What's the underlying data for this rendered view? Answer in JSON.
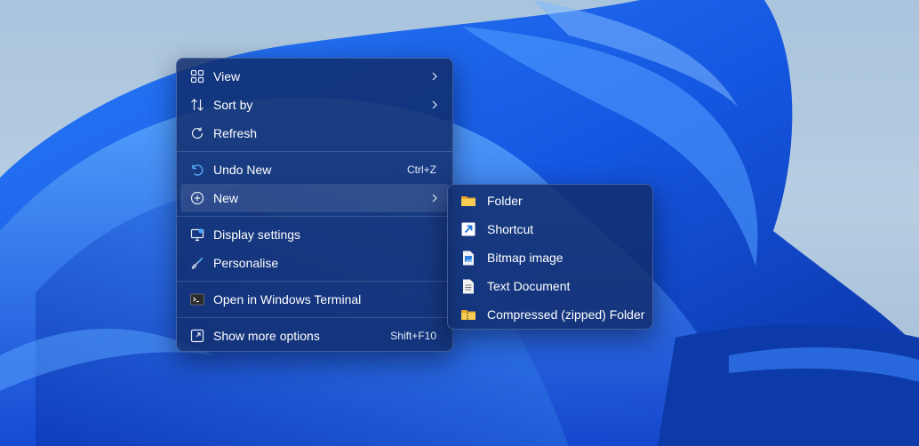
{
  "context_menu": {
    "items": [
      {
        "label": "View",
        "icon": "grid-icon",
        "submenu": true
      },
      {
        "label": "Sort by",
        "icon": "sort-icon",
        "submenu": true
      },
      {
        "label": "Refresh",
        "icon": "refresh-icon"
      },
      {
        "label": "Undo New",
        "icon": "undo-icon",
        "shortcut": "Ctrl+Z"
      },
      {
        "label": "New",
        "icon": "add-circle-icon",
        "submenu": true,
        "active": true
      },
      {
        "label": "Display settings",
        "icon": "display-settings-icon"
      },
      {
        "label": "Personalise",
        "icon": "brush-icon"
      },
      {
        "label": "Open in Windows Terminal",
        "icon": "terminal-icon"
      },
      {
        "label": "Show more options",
        "icon": "expand-icon",
        "shortcut": "Shift+F10"
      }
    ]
  },
  "new_submenu": {
    "items": [
      {
        "label": "Folder",
        "icon": "folder-icon"
      },
      {
        "label": "Shortcut",
        "icon": "shortcut-icon"
      },
      {
        "label": "Bitmap image",
        "icon": "bitmap-icon"
      },
      {
        "label": "Text Document",
        "icon": "text-document-icon"
      },
      {
        "label": "Compressed (zipped) Folder",
        "icon": "zip-folder-icon"
      }
    ]
  },
  "colors": {
    "menu_background": "#112d6e",
    "accent": "#4aa3ff",
    "folder": "#f5c542"
  }
}
